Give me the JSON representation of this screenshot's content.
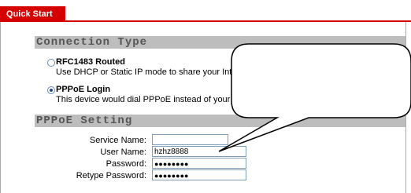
{
  "tab": {
    "label": "Quick Start"
  },
  "connection_type": {
    "title": "Connection Type",
    "options": [
      {
        "title": "RFC1483 Routed",
        "desc": "Use DHCP or Static IP mode to share your Internet connection",
        "selected": false
      },
      {
        "title": "PPPoE Login",
        "desc": "This device would dial PPPoE instead of your PC, you should",
        "selected": true
      }
    ]
  },
  "pppoe_setting": {
    "title": "PPPoE Setting",
    "fields": [
      {
        "label": "Service Name:",
        "value": ""
      },
      {
        "label": "User Name:",
        "value": "hzhz8888"
      },
      {
        "label": "Password:",
        "value": "●●●●●●●●"
      },
      {
        "label": "Retype Password:",
        "value": "●●●●●●●●"
      }
    ]
  }
}
